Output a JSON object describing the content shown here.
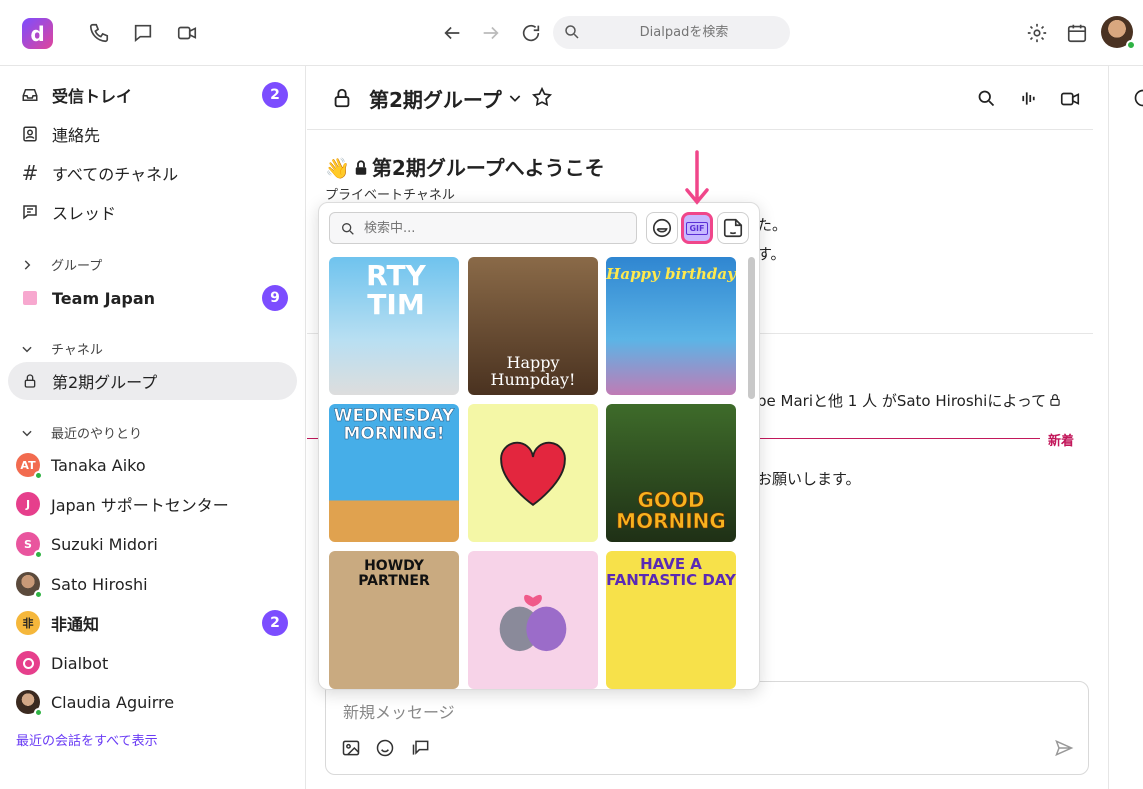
{
  "app": {
    "logo_letter": "d"
  },
  "topbar": {
    "search_placeholder": "Dialpadを検索"
  },
  "sidebar": {
    "inbox": {
      "label": "受信トレイ",
      "badge": "2"
    },
    "contacts": {
      "label": "連絡先"
    },
    "all_channels": {
      "label": "すべてのチャネル"
    },
    "threads": {
      "label": "スレッド"
    },
    "groups_section": "グループ",
    "team_japan": {
      "label": "Team Japan",
      "badge": "9"
    },
    "channels_section": "チャネル",
    "channel_2ki": {
      "label": "第2期グループ"
    },
    "recent_section": "最近のやりとり",
    "recent": [
      {
        "label": "Tanaka Aiko",
        "initials": "AT",
        "color": "#f26b4f"
      },
      {
        "label": "Japan サポートセンター",
        "initials": "J",
        "color": "#e63f8c"
      },
      {
        "label": "Suzuki Midori",
        "initials": "S",
        "color": "#e9559e"
      },
      {
        "label": "Sato Hiroshi",
        "initials": "",
        "color": "#7a6a5a"
      },
      {
        "label": "非通知",
        "initials": "非",
        "color": "#f5b73b",
        "badge": "2"
      },
      {
        "label": "Dialbot",
        "initials": "",
        "color": "#e63f8c"
      },
      {
        "label": "Claudia Aguirre",
        "initials": "",
        "color": "#4a3a30"
      }
    ],
    "show_all": "最近の会話をすべて表示"
  },
  "channel": {
    "title": "第2期グループ",
    "welcome": "第2期グループへようこそ",
    "welcome_emoji": "👋",
    "private_label": "プライベートチャネル",
    "frag1": "た。",
    "frag2": "す。",
    "frag3": "be Mariと他 1 人 がSato Hiroshiによって",
    "frag4": "お願いします。",
    "new_label": "新着"
  },
  "composer": {
    "placeholder": "新規メッセージ"
  },
  "picker": {
    "search_placeholder": "検索中...",
    "gif_tab": "GIF",
    "tiles": [
      {
        "caption": "RTY TIM",
        "bg": "#5fb6e6"
      },
      {
        "caption": "Happy Humpday!",
        "bg": "#6b4a2c"
      },
      {
        "caption": "Happy birthday",
        "bg": "#3a8fd6"
      },
      {
        "caption": "WEDNESDAY MORNING!",
        "bg": "#3da0e0"
      },
      {
        "caption": "",
        "bg": "#f4f7a6"
      },
      {
        "caption": "GOOD MORNING",
        "bg": "#2f4a22"
      },
      {
        "caption": "HOWDY PARTNER",
        "bg": "#c8a97e"
      },
      {
        "caption": "",
        "bg": "#f6d1e6"
      },
      {
        "caption": "HAVE A FANTASTIC DAY",
        "bg": "#f7e14a"
      }
    ]
  }
}
